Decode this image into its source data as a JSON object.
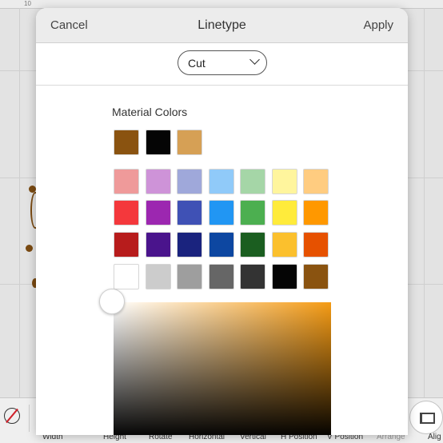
{
  "background": {
    "ruler_label": "10",
    "toolbar": [
      "Width",
      "Height",
      "Rotate",
      "Horizontal",
      "Vertical",
      "H Position",
      "V Position",
      "Arrange",
      "Alig"
    ]
  },
  "dialog": {
    "cancel_label": "Cancel",
    "title": "Linetype",
    "apply_label": "Apply",
    "linetype_select": {
      "value": "Cut"
    },
    "section_title": "Material Colors",
    "material_colors": [
      "#8a5310",
      "#050505",
      "#d6a055"
    ],
    "palette": [
      [
        "#ef9a9a",
        "#ce93d8",
        "#9fa8da",
        "#90caf9",
        "#a5d6a7",
        "#fff59d",
        "#ffcc80"
      ],
      [
        "#f4383c",
        "#9c27b0",
        "#3f51b5",
        "#2196f3",
        "#4caf50",
        "#ffeb3b",
        "#ff9800"
      ],
      [
        "#b71c1c",
        "#4a148c",
        "#1a237e",
        "#0d47a1",
        "#1b5e20",
        "#fbc02d",
        "#e65100"
      ],
      [
        "#ffffff",
        "#cccccc",
        "#9e9e9e",
        "#666666",
        "#333333",
        "#050505",
        "#8a5310"
      ]
    ],
    "picker_hue": "#f59b14"
  }
}
